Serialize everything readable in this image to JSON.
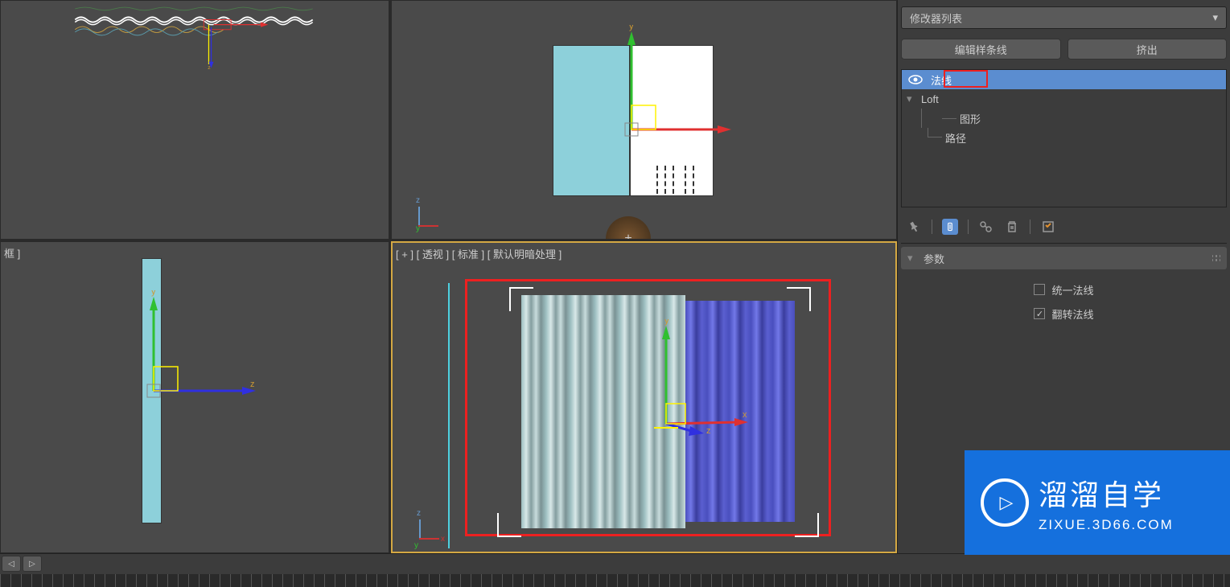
{
  "rightPanel": {
    "modifierListLabel": "修改器列表",
    "buttons": {
      "editSpline": "编辑样条线",
      "extrude": "挤出"
    },
    "stack": {
      "normal": "法线",
      "loft": "Loft",
      "shape": "图形",
      "path": "路径"
    },
    "paramsHeader": "参数",
    "checkboxes": {
      "unifyNormals": "统一法线",
      "flipNormals": "翻转法线"
    }
  },
  "viewports": {
    "bottomLeft": {
      "label": "框 ]"
    },
    "bottomRight": {
      "label": "[ + ]  [ 透视 ]  [ 标准 ]  [ 默认明暗处理 ]"
    }
  },
  "watermark": {
    "title": "溜溜自学",
    "url": "ZIXUE.3D66.COM"
  },
  "axisLabels": {
    "x": "x",
    "y": "y",
    "z": "z"
  }
}
